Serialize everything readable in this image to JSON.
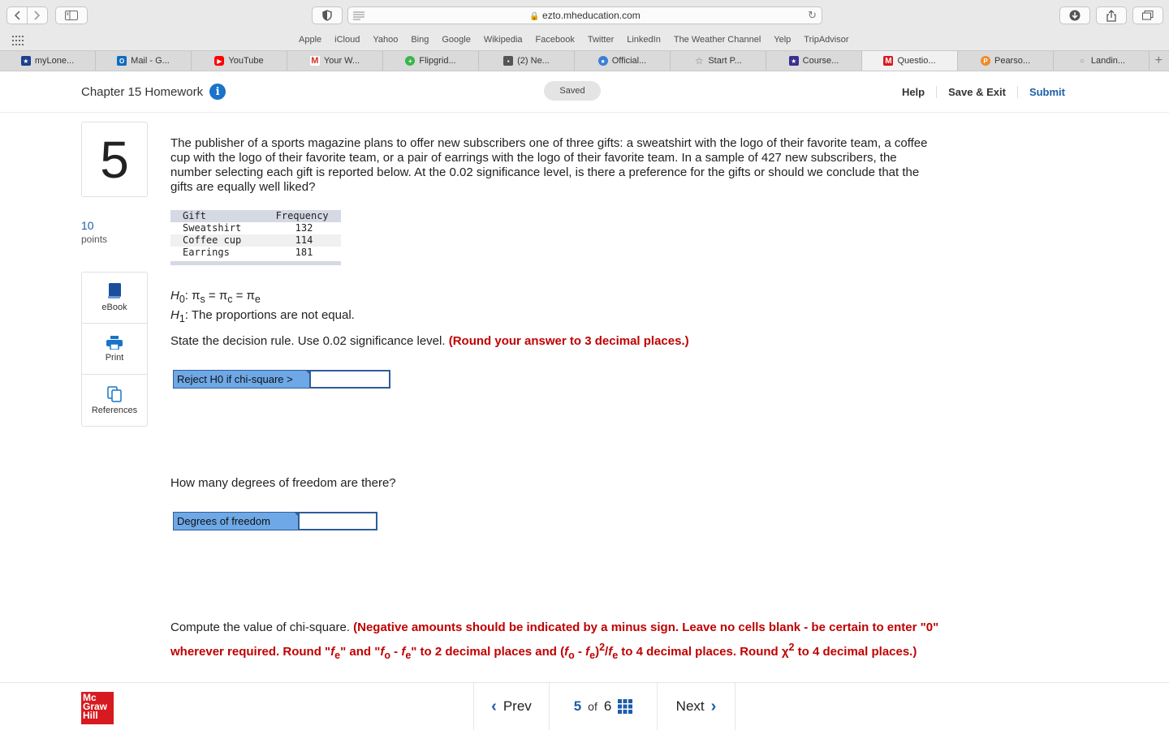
{
  "browser": {
    "url": "ezto.mheducation.com",
    "favorites": [
      "Apple",
      "iCloud",
      "Yahoo",
      "Bing",
      "Google",
      "Wikipedia",
      "Facebook",
      "Twitter",
      "LinkedIn",
      "The Weather Channel",
      "Yelp",
      "TripAdvisor"
    ],
    "tabs": [
      {
        "label": "myLone...",
        "icon": "lonestar-icon",
        "color": "#1d3f8f"
      },
      {
        "label": "Mail - G...",
        "icon": "outlook-icon",
        "color": "#0f6cbd"
      },
      {
        "label": "YouTube",
        "icon": "youtube-icon",
        "color": "#ff0000"
      },
      {
        "label": "Your W...",
        "icon": "gmail-icon",
        "color": "#d93025"
      },
      {
        "label": "Flipgrid...",
        "icon": "flipgrid-icon",
        "color": "#39b54a"
      },
      {
        "label": "(2) Ne...",
        "icon": "tv-icon",
        "color": "#555555"
      },
      {
        "label": "Official...",
        "icon": "globe-icon",
        "color": "#3b7fd6"
      },
      {
        "label": "Start P...",
        "icon": "star-icon",
        "color": "#777777"
      },
      {
        "label": "Course...",
        "icon": "course-star-icon",
        "color": "#3a2f8f"
      },
      {
        "label": "Questio...",
        "icon": "mcgraw-m-icon",
        "color": "#d61a1f"
      },
      {
        "label": "Pearso...",
        "icon": "pearson-icon",
        "color": "#f08a24"
      },
      {
        "label": "Landin...",
        "icon": "landing-icon",
        "color": "#888888"
      }
    ]
  },
  "header": {
    "title": "Chapter 15 Homework",
    "status": "Saved",
    "help": "Help",
    "save_exit": "Save & Exit",
    "submit": "Submit"
  },
  "question": {
    "number": "5",
    "points": "10",
    "points_label": "points",
    "text": "The publisher of a sports magazine plans to offer new subscribers one of three gifts: a sweatshirt with the logo of their favorite team, a coffee cup with the logo of their favorite team, or a pair of earrings with the logo of their favorite team. In a sample of 427 new subscribers, the number selecting each gift is reported below. At the 0.02 significance level, is there a preference for the gifts or should we conclude that the gifts are equally well liked?",
    "table": {
      "headers": [
        "Gift",
        "Frequency"
      ],
      "rows": [
        [
          "Sweatshirt",
          "132"
        ],
        [
          "Coffee cup",
          "114"
        ],
        [
          "Earrings",
          "181"
        ]
      ]
    },
    "h1_text": "The proportions are not equal.",
    "rule_prompt": "State the decision rule. Use 0.02 significance level.",
    "rule_note": "(Round your answer to 3 decimal places.)",
    "rule_label": "Reject H0 if chi-square >",
    "rule_value": "",
    "df_prompt": "How many degrees of freedom are there?",
    "df_label": "Degrees of freedom",
    "df_value": "",
    "chi_prompt": "Compute the value of chi-square."
  },
  "tools": [
    "eBook",
    "Print",
    "References"
  ],
  "footer": {
    "prev": "Prev",
    "current": "5",
    "of": "of",
    "total": "6",
    "next": "Next",
    "logo": [
      "Mc",
      "Graw",
      "Hill"
    ]
  }
}
